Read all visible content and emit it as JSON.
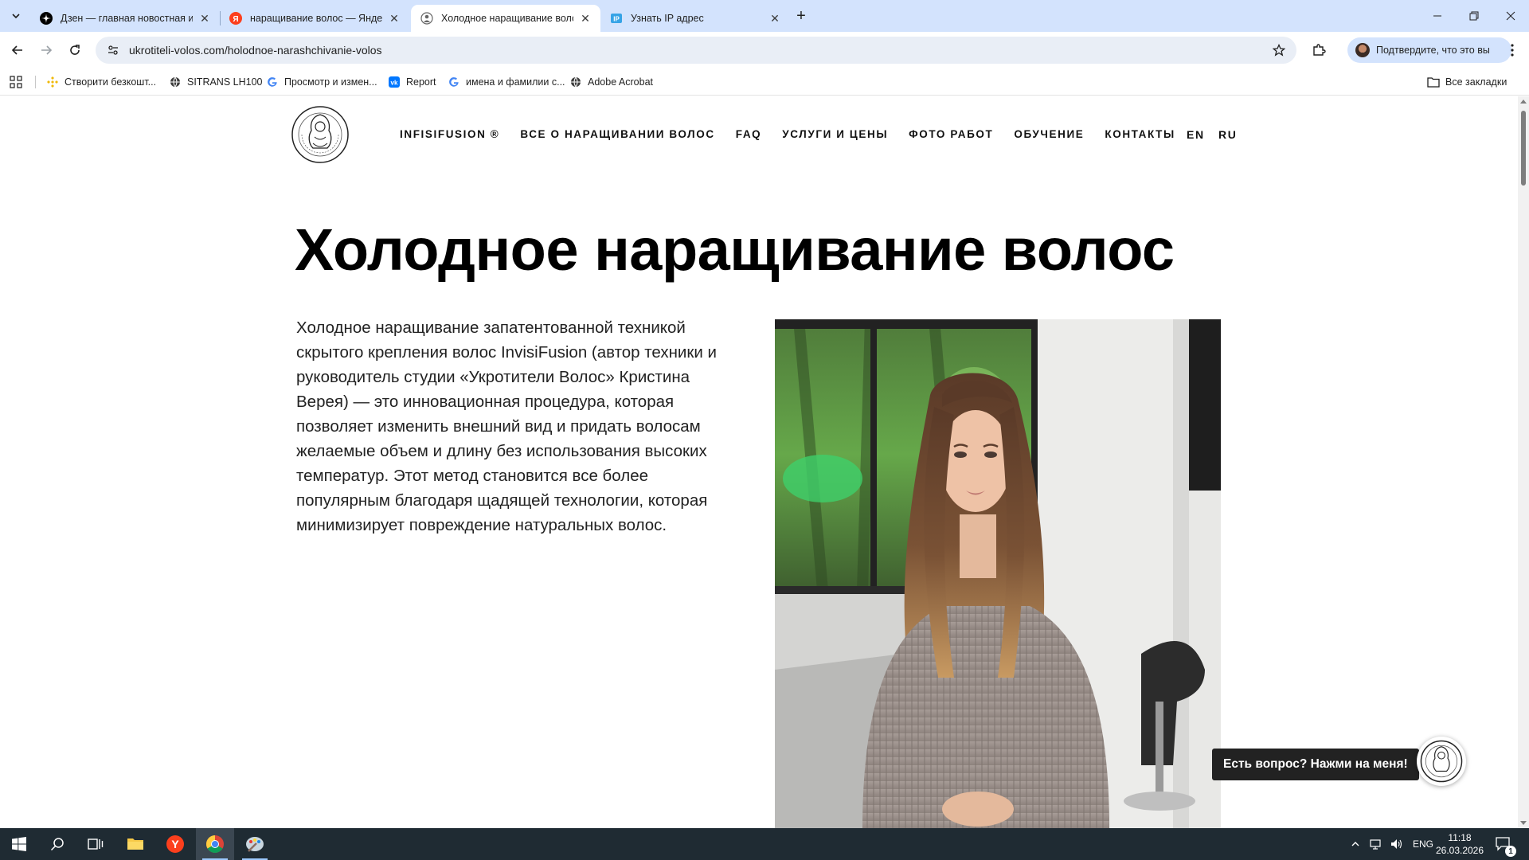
{
  "browser": {
    "tabs": [
      {
        "title": "Дзен — главная новостная ин",
        "favicon": "dzen-icon",
        "active": false
      },
      {
        "title": "наращивание волос — Яндекс",
        "favicon": "yandex-icon",
        "active": false
      },
      {
        "title": "Холодное наращивание волос",
        "favicon": "site-icon",
        "active": true
      },
      {
        "title": "Узнать IP адрес",
        "favicon": "ip-icon",
        "active": false
      }
    ],
    "url": "ukrotiteli-volos.com/holodnoe-narashchivanie-volos",
    "profile_label": "Подтвердите, что это вы",
    "bookmarks": [
      {
        "label": "Створити безкошт...",
        "icon": "binance-icon"
      },
      {
        "label": "SITRANS LH100",
        "icon": "globe-icon"
      },
      {
        "label": "Просмотр и измен...",
        "icon": "google-icon"
      },
      {
        "label": "Report",
        "icon": "vk-icon"
      },
      {
        "label": "имена и фамилии с...",
        "icon": "google-icon"
      },
      {
        "label": "Adobe Acrobat",
        "icon": "globe-icon"
      }
    ],
    "all_bookmarks_label": "Все закладки"
  },
  "site": {
    "nav": [
      "INFISIFUSION ®",
      "ВСЕ О НАРАЩИВАНИИ ВОЛОС",
      "FAQ",
      "УСЛУГИ И ЦЕНЫ",
      "ФОТО РАБОТ",
      "ОБУЧЕНИЕ",
      "КОНТАКТЫ"
    ],
    "lang_en": "EN",
    "lang_ru": "RU",
    "heading": "Холодное наращивание волос",
    "intro": "Холодное наращивание запатентованной техникой скрытого крепления волос InvisiFusion (автор техники и руководитель студии «Укротители Волос» Кристина Верея) — это инновационная процедура, которая позволяет изменить внешний вид и придать волосам желаемые объем и длину без использования высоких температур. Этот метод становится все более популярным благодаря щадящей технологии, которая минимизирует повреждение натуральных волос.",
    "chat_prompt": "Есть вопрос? Нажми на меня!"
  },
  "taskbar": {
    "lang": "ENG",
    "time": "11:18",
    "date": "26.03.2026",
    "notifications": "1"
  },
  "colors": {
    "tabstrip_bg": "#d3e3fd",
    "omnibox_bg": "#e9eef6",
    "taskbar_bg": "#1f2b33",
    "chat_bg": "#222222"
  }
}
